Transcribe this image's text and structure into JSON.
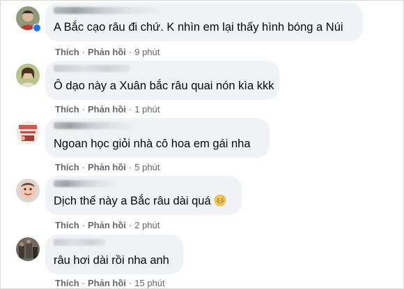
{
  "comments": [
    {
      "text": "A Bắc cạo râu đi chứ. K nhìn em lại thấy hình bóng a Núi",
      "like_label": "Thích",
      "reply_label": "Phản hồi",
      "time": "9 phút"
    },
    {
      "text": "Ô dạo này a Xuân bắc râu quai nón kìa kkk",
      "like_label": "Thích",
      "reply_label": "Phản hồi",
      "time": "1 phút"
    },
    {
      "text": "Ngoan học giỏi nhà cô hoa em gái nha",
      "like_label": "Thích",
      "reply_label": "Phản hồi",
      "time": "5 phút"
    },
    {
      "text": "Dịch thế này a Bắc râu dài quá",
      "emoji": "grinning-face-with-sweat",
      "like_label": "Thích",
      "reply_label": "Phản hồi",
      "time": "2 phút"
    },
    {
      "text": "râu hơi dài rồi nha anh",
      "like_label": "Thích",
      "reply_label": "Phản hồi",
      "time": "15 phút"
    }
  ],
  "separator": "·",
  "colors": {
    "bubble": "#f0f2f5",
    "meta_text": "#65676b",
    "comment_text": "#050505",
    "verified_badge": "#1877f2"
  }
}
